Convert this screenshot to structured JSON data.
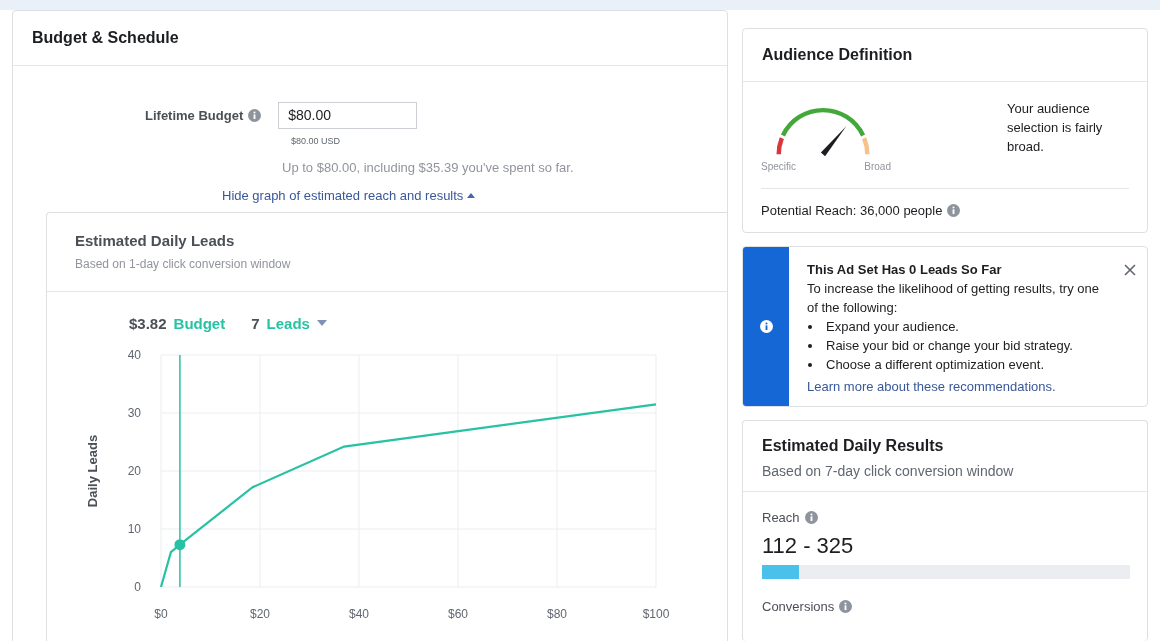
{
  "budget_schedule": {
    "title": "Budget & Schedule",
    "lifetime_budget": {
      "label": "Lifetime Budget",
      "value": "$80.00",
      "currency_note": "$80.00 USD"
    },
    "spend_note": "Up to $80.00, including $35.39 you've spent so far.",
    "toggle_link": "Hide graph of estimated reach and results",
    "graph": {
      "title": "Estimated Daily Leads",
      "subtitle": "Based on 1-day click conversion window",
      "summary": {
        "budget_value": "$3.82",
        "budget_label": "Budget",
        "leads_value": "7",
        "leads_label": "Leads"
      },
      "chart_data": {
        "type": "line",
        "ylabel": "Daily Leads",
        "x": [
          0,
          2,
          3.82,
          18.5,
          37,
          100
        ],
        "series": [
          {
            "color": "#26c2a3",
            "values": [
              0,
              6,
              7.3,
              17.2,
              24.2,
              31.5
            ]
          }
        ],
        "grid": true,
        "xlim": [
          0,
          100
        ],
        "ylim": [
          0,
          40
        ],
        "xticks": [
          {
            "value": 0,
            "label": "$0"
          },
          {
            "value": 20,
            "label": "$20"
          },
          {
            "value": 40,
            "label": "$40"
          },
          {
            "value": 60,
            "label": "$60"
          },
          {
            "value": 80,
            "label": "$80"
          },
          {
            "value": 100,
            "label": "$100"
          }
        ],
        "yticks": [
          0,
          10,
          20,
          30,
          40
        ],
        "ref_lines": [
          {
            "axis": "x",
            "value": 3.82
          }
        ]
      }
    }
  },
  "audience_definition": {
    "title": "Audience Definition",
    "gauge": {
      "low_label": "Specific",
      "high_label": "Broad"
    },
    "description": "Your audience selection is fairly broad.",
    "potential_reach": "Potential Reach: 36,000 people"
  },
  "alert": {
    "title": "This Ad Set Has 0 Leads So Far",
    "intro": "To increase the likelihood of getting results, try one of the following:",
    "tips": [
      "Expand your audience.",
      "Raise your bid or change your bid strategy.",
      "Choose a different optimization event."
    ],
    "link": "Learn more about these recommendations."
  },
  "daily_results": {
    "title": "Estimated Daily Results",
    "subtitle": "Based on 7-day click conversion window",
    "metrics": [
      {
        "label": "Reach",
        "value": "112 - 325",
        "level": 0.1
      },
      {
        "label": "Conversions"
      }
    ]
  }
}
